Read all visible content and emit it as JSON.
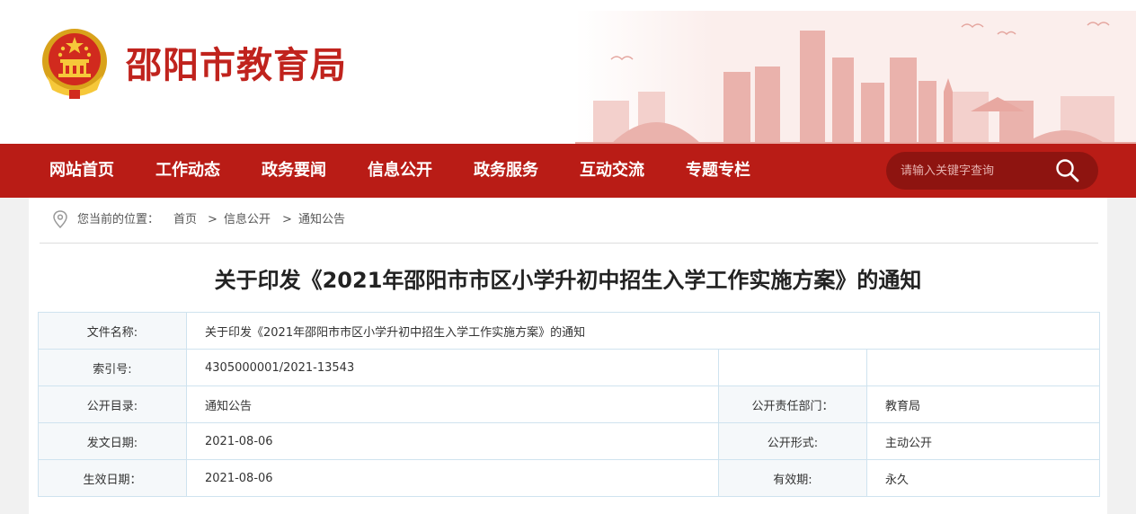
{
  "site": {
    "title": "邵阳市教育局"
  },
  "nav": {
    "items": [
      "网站首页",
      "工作动态",
      "政务要闻",
      "信息公开",
      "政务服务",
      "互动交流",
      "专题专栏"
    ],
    "search_placeholder": "请输入关键字查询"
  },
  "breadcrumb": {
    "prefix": "您当前的位置：",
    "items": [
      "首页",
      "信息公开",
      "通知公告"
    ],
    "separator": ">"
  },
  "article": {
    "title": "关于印发《2021年邵阳市市区小学升初中招生入学工作实施方案》的通知"
  },
  "meta": {
    "file_name_label": "文件名称:",
    "file_name": "关于印发《2021年邵阳市市区小学升初中招生入学工作实施方案》的通知",
    "index_label": "索引号:",
    "index_value": "4305000001/2021-13543",
    "catalog_label": "公开目录:",
    "catalog_value": "通知公告",
    "dept_label": "公开责任部门：",
    "dept_value": "教育局",
    "issue_date_label": "发文日期:",
    "issue_date": "2021-08-06",
    "form_label": "公开形式:",
    "form_value": "主动公开",
    "effective_date_label": "生效日期：",
    "effective_date": "2021-08-06",
    "validity_label": "有效期:",
    "validity_value": "永久"
  },
  "colors": {
    "brand_red": "#b91c16",
    "title_red": "#c0231d",
    "border_blue": "#cfe3ef"
  },
  "icons": [
    "national-emblem",
    "search-icon",
    "location-pin-icon"
  ]
}
